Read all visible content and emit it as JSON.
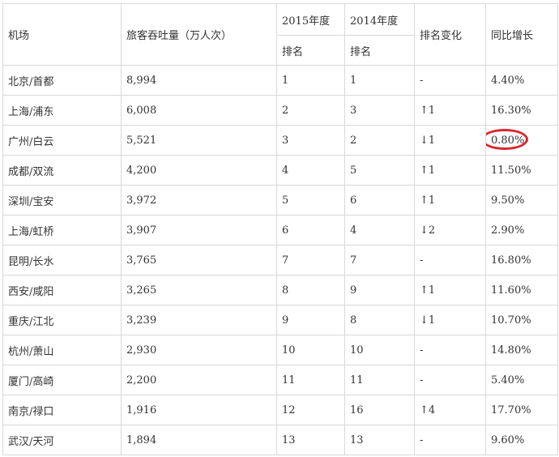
{
  "table": {
    "headers": {
      "airport": "机场",
      "throughput": "旅客吞吐量（万人次）",
      "year_2015": "2015年度",
      "year_2014": "2014年度",
      "rank_2015": "排名",
      "rank_2014": "排名",
      "rank_change": "排名变化",
      "growth": "同比增长"
    },
    "rows": [
      {
        "airport": "北京/首都",
        "throughput": "8,994",
        "rank_2015": "1",
        "rank_2014": "1",
        "change": "-",
        "growth": "4.40%"
      },
      {
        "airport": "上海/浦东",
        "throughput": "6,008",
        "rank_2015": "2",
        "rank_2014": "3",
        "change": "↑1",
        "growth": "16.30%"
      },
      {
        "airport": "广州/白云",
        "throughput": "5,521",
        "rank_2015": "3",
        "rank_2014": "2",
        "change": "↓1",
        "growth": "0.80%",
        "highlighted": true
      },
      {
        "airport": "成都/双流",
        "throughput": "4,200",
        "rank_2015": "4",
        "rank_2014": "5",
        "change": "↑1",
        "growth": "11.50%"
      },
      {
        "airport": "深圳/宝安",
        "throughput": "3,972",
        "rank_2015": "5",
        "rank_2014": "6",
        "change": "↑1",
        "growth": "9.50%"
      },
      {
        "airport": "上海/虹桥",
        "throughput": "3,907",
        "rank_2015": "6",
        "rank_2014": "4",
        "change": "↓2",
        "growth": "2.90%"
      },
      {
        "airport": "昆明/长水",
        "throughput": "3,765",
        "rank_2015": "7",
        "rank_2014": "7",
        "change": "-",
        "growth": "16.80%"
      },
      {
        "airport": "西安/咸阳",
        "throughput": "3,265",
        "rank_2015": "8",
        "rank_2014": "9",
        "change": "↑1",
        "growth": "11.60%"
      },
      {
        "airport": "重庆/江北",
        "throughput": "3,239",
        "rank_2015": "9",
        "rank_2014": "8",
        "change": "↓1",
        "growth": "10.70%"
      },
      {
        "airport": "杭州/萧山",
        "throughput": "2,930",
        "rank_2015": "10",
        "rank_2014": "10",
        "change": "-",
        "growth": "14.80%"
      },
      {
        "airport": "厦门/高崎",
        "throughput": "2,200",
        "rank_2015": "11",
        "rank_2014": "11",
        "change": "-",
        "growth": "5.40%"
      },
      {
        "airport": "南京/禄口",
        "throughput": "1,916",
        "rank_2015": "12",
        "rank_2014": "16",
        "change": "↑4",
        "growth": "17.70%"
      },
      {
        "airport": "武汉/天河",
        "throughput": "1,894",
        "rank_2015": "13",
        "rank_2014": "13",
        "change": "-",
        "growth": "9.60%"
      }
    ]
  },
  "colors": {
    "highlight_ring": "#d9282f",
    "grid_line": "#d9d9d9",
    "text": "#333333"
  }
}
